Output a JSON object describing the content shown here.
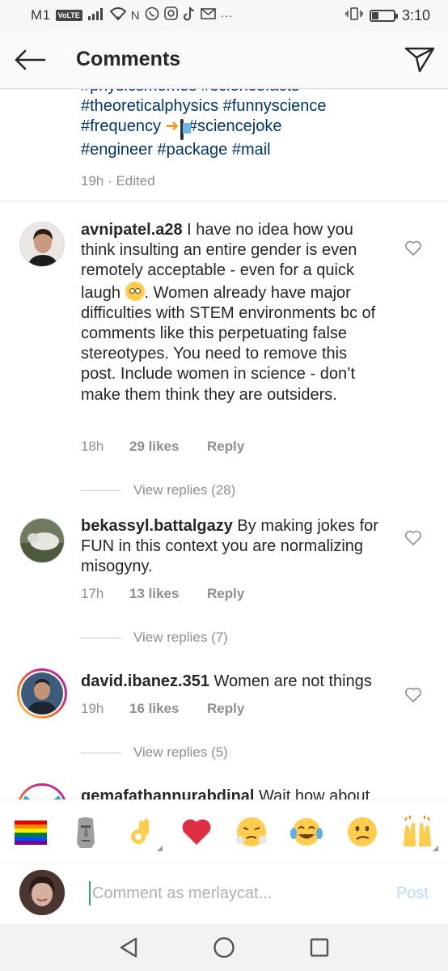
{
  "status_bar": {
    "carrier": "M1",
    "volte": "VoLTE",
    "time": "3:10",
    "battery_level": 0.3
  },
  "header": {
    "title": "Comments",
    "back_icon": "arrow-left-icon",
    "share_icon": "send-icon"
  },
  "caption": {
    "hashtag_lines": [
      "#physicsmemes #sciencefacts",
      "#theoreticalphysics #funnyscience",
      "#frequency",
      "#engineer #package #mail"
    ],
    "sciencejoke": "#sciencejoke",
    "meta": "19h · Edited"
  },
  "comments": [
    {
      "username": "avnipatel.a28",
      "text_before_emoji": " I have no idea how you think insulting an entire gender is even remotely acceptable - even for a quick laugh ",
      "text_after_emoji": ". Women already have major difficulties with STEM environments bc of comments like this perpetuating false stereotypes. You need to remove this post. Include women in science - don’t make them think they are outsiders.",
      "time": "18h",
      "likes": "29 likes",
      "reply": "Reply",
      "view_replies": "View replies (28)"
    },
    {
      "username": "bekassyl.battalgazy",
      "text": " By making jokes for FUN in this context you are normalizing misogyny.",
      "time": "17h",
      "likes": "13 likes",
      "reply": "Reply",
      "view_replies": "View replies (7)"
    },
    {
      "username": "david.ibanez.351",
      "text": " Women are not things",
      "time": "19h",
      "likes": "16 likes",
      "reply": "Reply",
      "view_replies": "View replies (5)"
    },
    {
      "username": "gemafathannurabdinal",
      "text": " Wait how about"
    }
  ],
  "emoji_bar": [
    {
      "name": "rainbow-flag",
      "glyph": "🏳️‍🌈"
    },
    {
      "name": "moai",
      "glyph": "🗿"
    },
    {
      "name": "ok-hand",
      "glyph": "👌"
    },
    {
      "name": "red-heart",
      "glyph": "❤️"
    },
    {
      "name": "triumph-face",
      "glyph": "😤"
    },
    {
      "name": "tears-of-joy",
      "glyph": "😂"
    },
    {
      "name": "confused-face",
      "glyph": "😕"
    },
    {
      "name": "raising-hands",
      "glyph": "🙌"
    }
  ],
  "composer": {
    "placeholder": "Comment as merlaycat...",
    "post_label": "Post"
  },
  "colors": {
    "hashtag": "#003569",
    "meta_gray": "#8e8e8e",
    "post_disabled": "#b3dbff"
  }
}
